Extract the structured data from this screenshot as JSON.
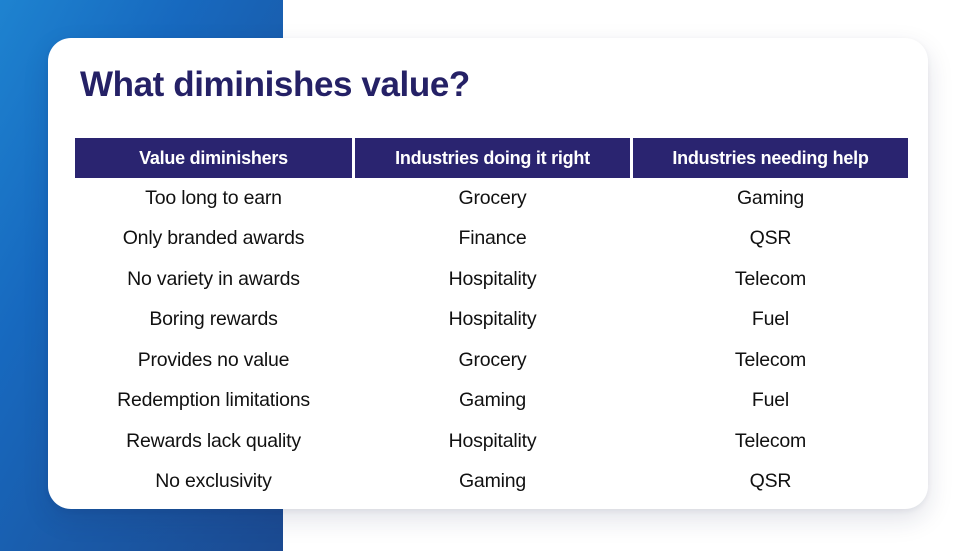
{
  "slide": {
    "title": "What diminishes value?",
    "accent_colors": {
      "panel_light": "#1e83d0",
      "panel_dark": "#1b4a91",
      "title_navy": "#252166",
      "header_navy": "#2a2470",
      "card_background": "#ffffff",
      "body_text": "#111111"
    }
  },
  "table": {
    "columns": [
      "Value diminishers",
      "Industries doing it right",
      "Industries needing help"
    ],
    "rows": [
      [
        "Too long to earn",
        "Grocery",
        "Gaming"
      ],
      [
        "Only branded awards",
        "Finance",
        "QSR"
      ],
      [
        "No variety in awards",
        "Hospitality",
        "Telecom"
      ],
      [
        "Boring rewards",
        "Hospitality",
        "Fuel"
      ],
      [
        "Provides no value",
        "Grocery",
        "Telecom"
      ],
      [
        "Redemption limitations",
        "Gaming",
        "Fuel"
      ],
      [
        "Rewards lack quality",
        "Hospitality",
        "Telecom"
      ],
      [
        "No exclusivity",
        "Gaming",
        "QSR"
      ]
    ]
  }
}
